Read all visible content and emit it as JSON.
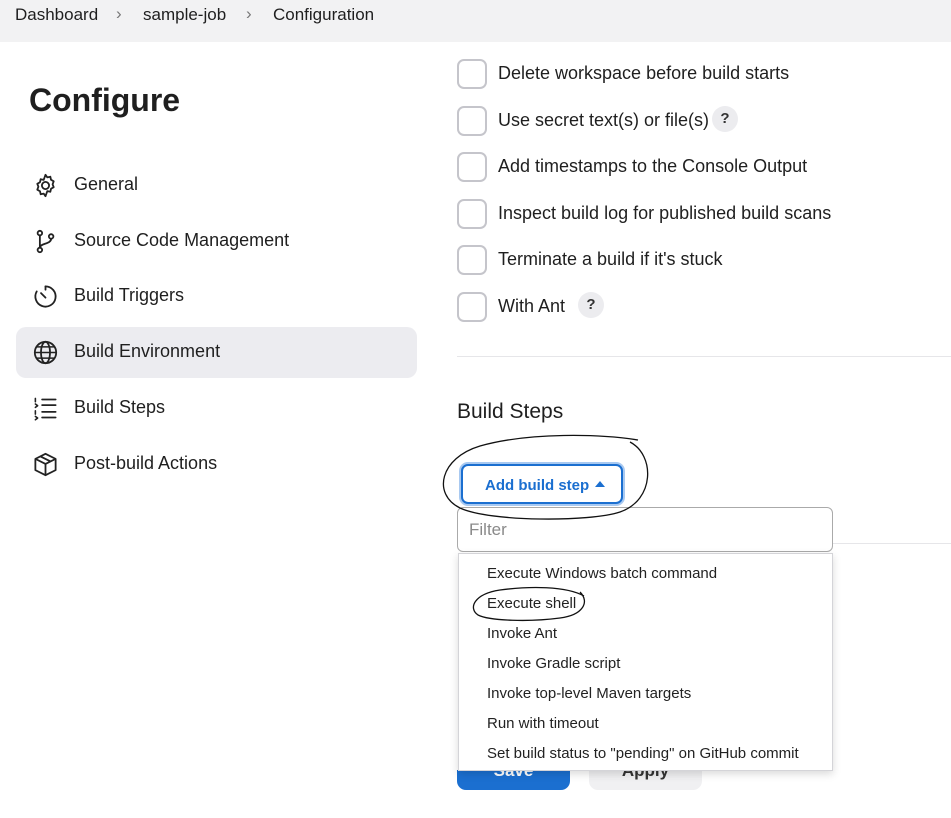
{
  "breadcrumb": [
    "Dashboard",
    "sample-job",
    "Configuration"
  ],
  "page_title": "Configure",
  "sidebar": {
    "items": [
      {
        "label": "General",
        "icon": "gear-icon"
      },
      {
        "label": "Source Code Management",
        "icon": "git-branch-icon"
      },
      {
        "label": "Build Triggers",
        "icon": "timer-icon"
      },
      {
        "label": "Build Environment",
        "icon": "globe-icon",
        "active": true
      },
      {
        "label": "Build Steps",
        "icon": "list-steps-icon"
      },
      {
        "label": "Post-build Actions",
        "icon": "package-icon"
      }
    ]
  },
  "build_environment": {
    "options": [
      {
        "label": "Delete workspace before build starts",
        "checked": false
      },
      {
        "label": "Use secret text(s) or file(s)",
        "checked": false,
        "help": "?"
      },
      {
        "label": "Add timestamps to the Console Output",
        "checked": false
      },
      {
        "label": "Inspect build log for published build scans",
        "checked": false
      },
      {
        "label": "Terminate a build if it's stuck",
        "checked": false
      },
      {
        "label": "With Ant",
        "checked": false,
        "help": "?"
      }
    ]
  },
  "build_steps": {
    "title": "Build Steps",
    "add_button_label": "Add build step",
    "filter_placeholder": "Filter",
    "menu_items": [
      "Execute Windows batch command",
      "Execute shell",
      "Invoke Ant",
      "Invoke Gradle script",
      "Invoke top-level Maven targets",
      "Run with timeout",
      "Set build status to \"pending\" on GitHub commit"
    ]
  },
  "footer": {
    "save_label": "Save",
    "apply_label": "Apply"
  },
  "colors": {
    "accent": "#1b6fd0",
    "active_nav_bg": "#ececf0"
  }
}
